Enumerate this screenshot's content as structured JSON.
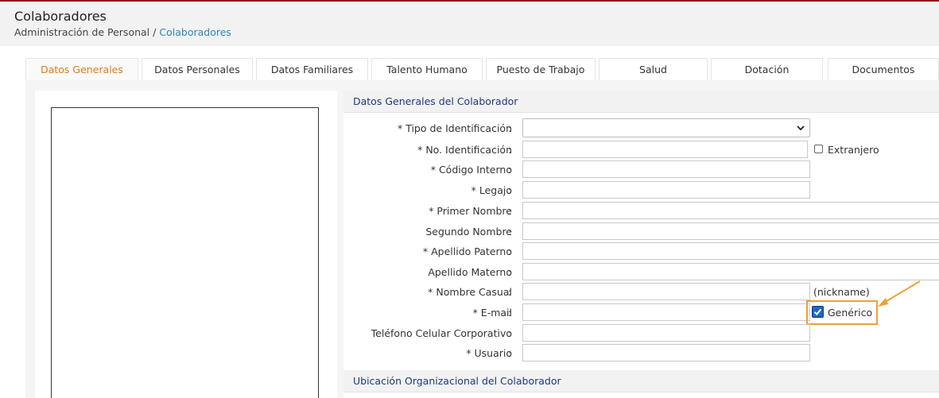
{
  "header": {
    "title": "Colaboradores",
    "breadcrumb": {
      "root": "Administración de Personal",
      "separator": "/",
      "current": "Colaboradores"
    }
  },
  "tabs": [
    {
      "label": "Datos Generales",
      "active": true
    },
    {
      "label": "Datos Personales",
      "active": false
    },
    {
      "label": "Datos Familiares",
      "active": false
    },
    {
      "label": "Talento Humano",
      "active": false
    },
    {
      "label": "Puesto de Trabajo",
      "active": false
    },
    {
      "label": "Salud",
      "active": false
    },
    {
      "label": "Dotación",
      "active": false
    },
    {
      "label": "Documentos",
      "active": false
    }
  ],
  "sections": {
    "general": "Datos Generales del Colaborador",
    "organizational": "Ubicación Organizacional del Colaborador"
  },
  "form": {
    "tipo_identificacion": {
      "label": "* Tipo de Identificación",
      "value": ""
    },
    "no_identificacion": {
      "label": "* No. Identificación",
      "value": ""
    },
    "extranjero": {
      "label": "Extranjero",
      "checked": false
    },
    "codigo_interno": {
      "label": "* Código Interno",
      "value": ""
    },
    "legajo": {
      "label": "* Legajo",
      "value": ""
    },
    "primer_nombre": {
      "label": "* Primer Nombre",
      "value": ""
    },
    "segundo_nombre": {
      "label": "Segundo Nombre",
      "value": ""
    },
    "apellido_paterno": {
      "label": "* Apellido Paterno",
      "value": ""
    },
    "apellido_materno": {
      "label": "Apellido Materno",
      "value": ""
    },
    "nombre_casual": {
      "label": "* Nombre Casual",
      "value": "",
      "hint": "(nickname)"
    },
    "email": {
      "label": "* E-mail",
      "value": ""
    },
    "generico": {
      "label": "Genérico",
      "checked": true
    },
    "telefono": {
      "label": "Teléfono Celular Corporativo",
      "value": ""
    },
    "usuario": {
      "label": "* Usuario",
      "value": ""
    },
    "colon": ":"
  },
  "colors": {
    "accent_active_tab": "#e07b1a",
    "breadcrumb_link": "#2a86b8",
    "section_title": "#1e3a7a",
    "annotation": "#f0a035",
    "checkbox_checked": "#1e66d0"
  },
  "icons": [
    "chevron-down-icon",
    "check-icon",
    "annotation-arrow-icon"
  ]
}
